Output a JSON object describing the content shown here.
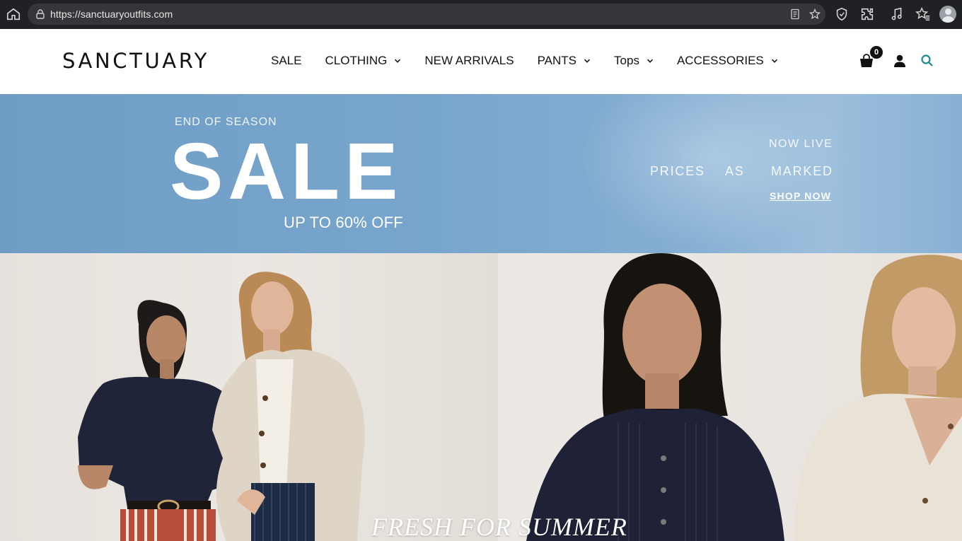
{
  "browser": {
    "url": "https://sanctuaryoutfits.com"
  },
  "header": {
    "logo": "SANCTUARY",
    "cart_count": "0",
    "nav": [
      {
        "label": "SALE",
        "has_dropdown": false
      },
      {
        "label": "CLOTHING",
        "has_dropdown": true
      },
      {
        "label": "NEW ARRIVALS",
        "has_dropdown": false
      },
      {
        "label": "PANTS",
        "has_dropdown": true
      },
      {
        "label": "Tops",
        "has_dropdown": true
      },
      {
        "label": "ACCESSORIES",
        "has_dropdown": true
      }
    ],
    "icons": [
      "cart-icon",
      "account-icon",
      "search-icon"
    ],
    "search_icon_color": "#1a8c8c"
  },
  "banner": {
    "eyebrow": "END OF SEASON",
    "headline": "SALE",
    "discount": "UP TO 60% OFF",
    "now_live": "NOW LIVE",
    "prices_words": [
      "PRICES",
      "AS",
      "MARKED"
    ],
    "cta": "SHOP NOW",
    "background_color": "#78a5cc"
  },
  "hero": {
    "caption": "FRESH FOR SUMMER"
  }
}
